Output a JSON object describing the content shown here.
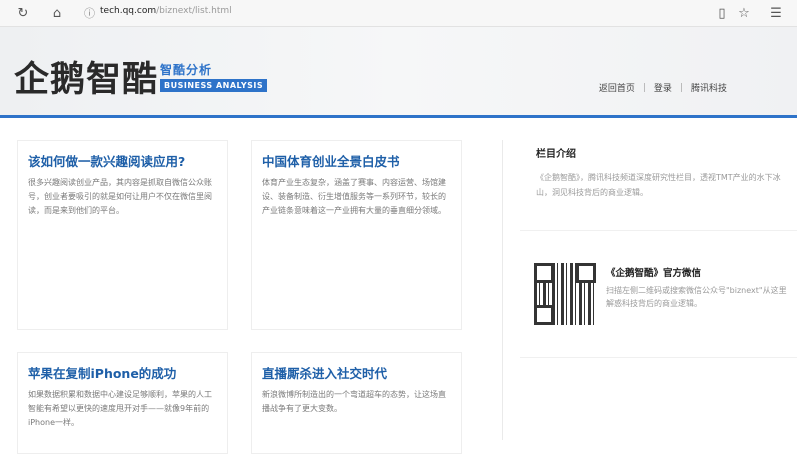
{
  "browser": {
    "url_host": "tech.qq.com",
    "url_path": "/biznext/list.html"
  },
  "header": {
    "logo_text": "企鹅智酷",
    "logo_sub": "智酷分析",
    "logo_en": "BUSINESS ANALYSIS",
    "nav": [
      {
        "label": "返回首页"
      },
      {
        "label": "登录"
      },
      {
        "label": "腾讯科技"
      }
    ]
  },
  "articles": [
    {
      "title": "该如何做一款兴趣阅读应用?",
      "desc": "很多兴趣阅读创业产品，其内容是抓取自微信公众账号，创业者要吸引的就是如何让用户不仅在微信里阅读，而是来到他们的平台。"
    },
    {
      "title": "中国体育创业全景白皮书",
      "desc": "体育产业生态复杂，涵盖了赛事、内容运营、场馆建设、装备制造、衍生增值服务等一系列环节，较长的产业链条意味着这一产业拥有大量的垂直细分领域。"
    },
    {
      "title": "苹果在复制iPhone的成功",
      "desc": "如果数据积累和数据中心建设足够顺利，苹果的人工智能有希望以更快的速度甩开对手——就像9年前的iPhone一样。"
    },
    {
      "title": "直播厮杀进入社交时代",
      "desc": "新浪微博所制造出的一个弯道超车的态势，让这场直播战争有了更大变数。"
    }
  ],
  "sidebar": {
    "intro_title": "栏目介绍",
    "intro_desc": "《企鹅智酷》，腾讯科技频道深度研究性栏目，透视TMT产业的水下冰山，洞见科技背后的商业逻辑。",
    "wechat_title": "《企鹅智酷》官方微信",
    "wechat_desc": "扫描左侧二维码或搜索微信公众号\"biznext\"从这里解惑科技背后的商业逻辑。"
  }
}
